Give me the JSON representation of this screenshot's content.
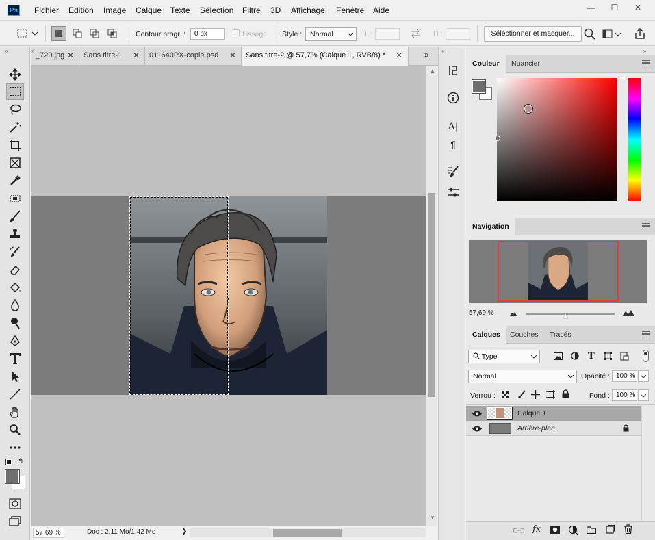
{
  "app": {
    "logo": "Ps"
  },
  "menu": [
    "Fichier",
    "Edition",
    "Image",
    "Calque",
    "Texte",
    "Sélection",
    "Filtre",
    "3D",
    "Affichage",
    "Fenêtre",
    "Aide"
  ],
  "window_buttons": {
    "minimize": "—",
    "restore": "☐",
    "close": "✕"
  },
  "options": {
    "feather_label": "Contour progr. :",
    "feather_value": "0 px",
    "antialias_label": "Lissage",
    "style_label": "Style :",
    "style_value": "Normal",
    "w_label": "L :",
    "h_label": "H :",
    "mask_button": "Sélectionner et masquer..."
  },
  "tabs": [
    {
      "label": "_720.jpg",
      "active": false
    },
    {
      "label": "Sans titre-1",
      "active": false
    },
    {
      "label": "011640PX-copie.psd",
      "active": false
    },
    {
      "label": "Sans titre-2 @ 57,7% (Calque 1, RVB/8) *",
      "active": true
    }
  ],
  "status": {
    "zoom": "57,69 %",
    "doc": "Doc : 2,11 Mo/1,42 Mo",
    "arrow": "❯"
  },
  "color_panel": {
    "tabs": [
      "Couleur",
      "Nuancier"
    ],
    "fg": "#6f6f6f",
    "bg": "#ffffff",
    "hue": "#ff0000"
  },
  "navigation_panel": {
    "tab": "Navigation",
    "zoom": "57,69 %"
  },
  "layers_panel": {
    "tabs": [
      "Calques",
      "Couches",
      "Tracés"
    ],
    "filter": "Type",
    "blend": "Normal",
    "opacity_label": "Opacité :",
    "opacity": "100 %",
    "lock_label": "Verrou :",
    "fill_label": "Fond :",
    "fill": "100 %",
    "layers": [
      {
        "name": "Calque 1",
        "selected": true,
        "locked": false
      },
      {
        "name": "Arrière-plan",
        "selected": false,
        "locked": true
      }
    ]
  },
  "colors": {
    "accent": "#e43b3b",
    "canvas": "#c0c0c0",
    "selection": "#ffffff"
  }
}
